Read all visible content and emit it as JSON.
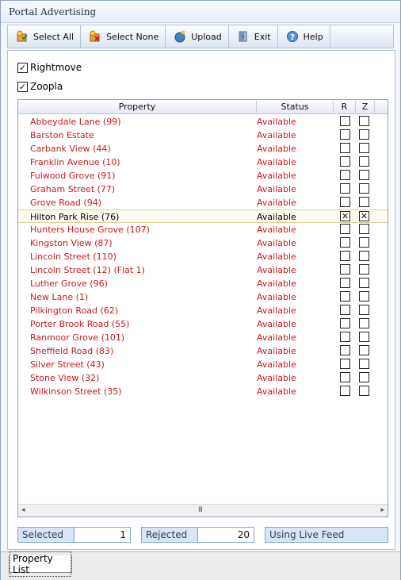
{
  "window": {
    "title": "Portal Advertising"
  },
  "toolbar": {
    "buttons": [
      {
        "label": "Select All",
        "icon": "select-all-icon"
      },
      {
        "label": "Select None",
        "icon": "select-none-icon"
      },
      {
        "label": "Upload",
        "icon": "upload-icon"
      },
      {
        "label": "Exit",
        "icon": "exit-icon"
      },
      {
        "label": "Help",
        "icon": "help-icon"
      }
    ]
  },
  "portals": [
    {
      "label": "Rightmove",
      "checked": true
    },
    {
      "label": "Zoopla",
      "checked": true
    }
  ],
  "grid": {
    "columns": {
      "property": "Property",
      "status": "Status",
      "r": "R",
      "z": "Z"
    },
    "rows": [
      {
        "property": "Abbeydale Lane (99)",
        "status": "Available",
        "r": false,
        "z": false
      },
      {
        "property": "Barston Estate",
        "status": "Available",
        "r": false,
        "z": false
      },
      {
        "property": "Carbank View (44)",
        "status": "Available",
        "r": false,
        "z": false
      },
      {
        "property": "Franklin Avenue (10)",
        "status": "Available",
        "r": false,
        "z": false
      },
      {
        "property": "Fulwood Grove (91)",
        "status": "Available",
        "r": false,
        "z": false
      },
      {
        "property": "Graham Street (77)",
        "status": "Available",
        "r": false,
        "z": false
      },
      {
        "property": "Grove Road (94)",
        "status": "Available",
        "r": false,
        "z": false
      },
      {
        "property": "Hilton Park Rise (76)",
        "status": "Available",
        "r": true,
        "z": true,
        "selected": true
      },
      {
        "property": "Hunters House Grove (107)",
        "status": "Available",
        "r": false,
        "z": false
      },
      {
        "property": "Kingston View (87)",
        "status": "Available",
        "r": false,
        "z": false
      },
      {
        "property": "Lincoln Street (110)",
        "status": "Available",
        "r": false,
        "z": false
      },
      {
        "property": "Lincoln Street (12) (Flat 1)",
        "status": "Available",
        "r": false,
        "z": false
      },
      {
        "property": "Luther Grove (96)",
        "status": "Available",
        "r": false,
        "z": false
      },
      {
        "property": "New Lane (1)",
        "status": "Available",
        "r": false,
        "z": false
      },
      {
        "property": "Pilkington Road (62)",
        "status": "Available",
        "r": false,
        "z": false
      },
      {
        "property": "Porter Brook Road (55)",
        "status": "Available",
        "r": false,
        "z": false
      },
      {
        "property": "Ranmoor Grove (101)",
        "status": "Available",
        "r": false,
        "z": false
      },
      {
        "property": "Sheffield Road (83)",
        "status": "Available",
        "r": false,
        "z": false
      },
      {
        "property": "Silver Street (43)",
        "status": "Available",
        "r": false,
        "z": false
      },
      {
        "property": "Stone View (32)",
        "status": "Available",
        "r": false,
        "z": false
      },
      {
        "property": "Wilkinson Street (35)",
        "status": "Available",
        "r": false,
        "z": false
      }
    ],
    "scroll_grip": "III"
  },
  "statusbar": {
    "selected_label": "Selected",
    "selected_value": "1",
    "rejected_label": "Rejected",
    "rejected_value": "20",
    "feed_label": "Using Live Feed"
  },
  "tabs": [
    {
      "label": "Property List"
    }
  ],
  "colors": {
    "available_text": "#cc1a1a",
    "accent": "#7fa6d4"
  }
}
